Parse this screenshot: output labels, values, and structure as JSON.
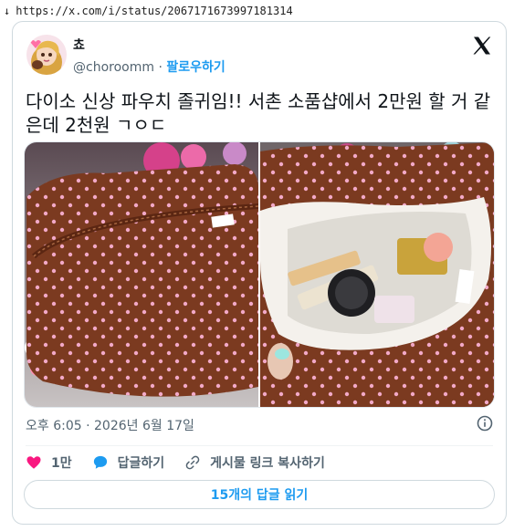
{
  "address_bar": {
    "arrow": "↓",
    "url": "https://x.com/i/status/2067171673997181314"
  },
  "tweet": {
    "author_name": "쵸",
    "handle": "@choroomm",
    "separator": "·",
    "follow_label": "팔로우하기",
    "text": "다이소 신상 파우치 졸귀임!! 서촌 소품샵에서 2만원 할 거 같은데 2천원 ㄱㅇㄷ",
    "timestamp": "오후 6:05 · 2026년 6월 17일",
    "likes_count": "1만",
    "reply_label": "답글하기",
    "copy_link_label": "게시물 링크 복사하기",
    "read_replies_label": "15개의 답글 읽기"
  },
  "icons": {
    "x_logo": "x-logo-icon",
    "info": "info-icon",
    "heart": "heart-icon",
    "reply": "speech-bubble-icon",
    "link": "link-icon"
  },
  "colors": {
    "accent": "#1d9bf0",
    "heart": "#f91880",
    "muted_text": "#536471",
    "border": "#cfd9de"
  }
}
